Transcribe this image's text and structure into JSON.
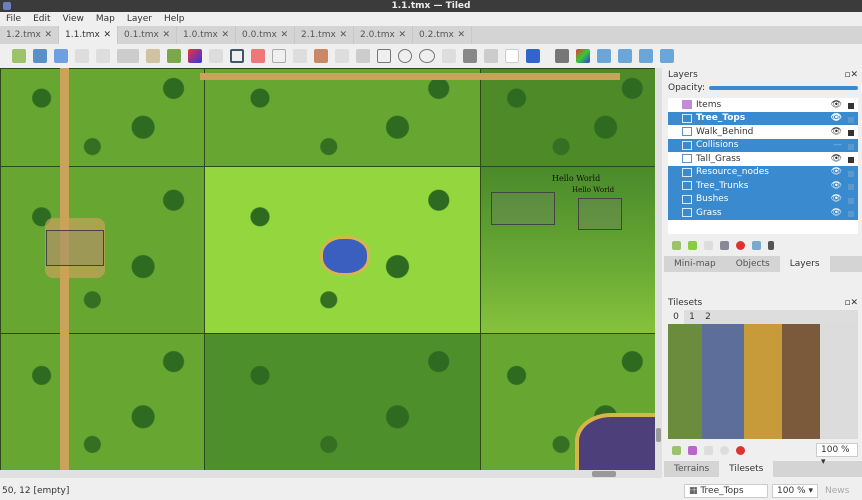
{
  "window": {
    "title": "1.1.tmx — Tiled"
  },
  "menu": [
    "File",
    "Edit",
    "View",
    "Map",
    "Layer",
    "Help"
  ],
  "tabs": [
    {
      "label": "1.2.tmx"
    },
    {
      "label": "1.1.tmx",
      "active": true
    },
    {
      "label": "0.1.tmx"
    },
    {
      "label": "1.0.tmx"
    },
    {
      "label": "0.0.tmx"
    },
    {
      "label": "2.1.tmx"
    },
    {
      "label": "2.0.tmx"
    },
    {
      "label": "0.2.tmx"
    }
  ],
  "map": {
    "labels": [
      "Hello World",
      "Hello World"
    ]
  },
  "layers_panel": {
    "title": "Layers",
    "opacity_label": "Opacity:",
    "opacity": 0.98,
    "layers": [
      {
        "name": "Items",
        "type": "object",
        "selected": false,
        "visible": true
      },
      {
        "name": "Tree_Tops",
        "type": "tile",
        "selected": true,
        "visible": true,
        "bold": true
      },
      {
        "name": "Walk_Behind",
        "type": "tile",
        "selected": false,
        "visible": true
      },
      {
        "name": "Collisions",
        "type": "tile",
        "selected": true,
        "visible": false
      },
      {
        "name": "Tall_Grass",
        "type": "tile",
        "selected": false,
        "visible": true
      },
      {
        "name": "Resource_nodes",
        "type": "tile",
        "selected": true,
        "visible": true
      },
      {
        "name": "Tree_Trunks",
        "type": "tile",
        "selected": true,
        "visible": true
      },
      {
        "name": "Bushes",
        "type": "tile",
        "selected": true,
        "visible": true
      },
      {
        "name": "Grass",
        "type": "tile",
        "selected": true,
        "visible": true
      }
    ],
    "tabs": [
      "Mini-map",
      "Objects",
      "Layers"
    ],
    "active_tab": "Layers"
  },
  "tilesets_panel": {
    "title": "Tilesets",
    "numbers": [
      "0",
      "1",
      "2"
    ],
    "zoom": "100 %",
    "tabs": [
      "Terrains",
      "Tilesets"
    ],
    "active_tab": "Tilesets"
  },
  "status": {
    "coords": "50, 12 [empty]",
    "layer": "Tree_Tops",
    "zoom": "100 %",
    "news": "News"
  },
  "colors": {
    "selection": "#3a8ad0",
    "titlebar": "#3b3b3b"
  }
}
